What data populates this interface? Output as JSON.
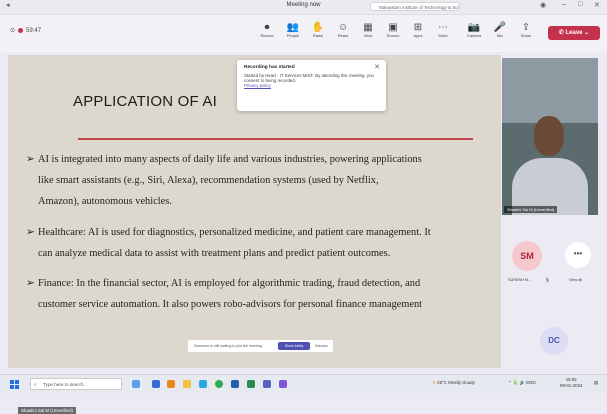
{
  "window": {
    "title": "Meeting now",
    "search_text": "Malayalam Institute of Technology & Science"
  },
  "toolbar": {
    "timer": "59:47",
    "items": [
      {
        "label": "Record",
        "glyph": "⏺"
      },
      {
        "label": "People",
        "glyph": "👥"
      },
      {
        "label": "Raise",
        "glyph": "✋"
      },
      {
        "label": "React",
        "glyph": "☺"
      },
      {
        "label": "View",
        "glyph": "▦"
      },
      {
        "label": "Rooms",
        "glyph": "▣"
      },
      {
        "label": "Apps",
        "glyph": "⊞"
      },
      {
        "label": "More",
        "glyph": "⋯"
      },
      {
        "label": "Camera",
        "glyph": "📷"
      },
      {
        "label": "Mic",
        "glyph": "🎤"
      },
      {
        "label": "Share",
        "glyph": "⇪"
      }
    ],
    "leave_label": "Leave"
  },
  "slide": {
    "title": "APPLICATION OF AI",
    "bullets": [
      {
        "lines": [
          "AI is integrated into many aspects of daily life and various industries, powering applications",
          "like smart assistants (e.g., Siri,  Alexa),  recommendation systems (used by Netflix,",
          "Amazon), autonomous vehicles."
        ]
      },
      {
        "lines": [
          "Healthcare: AI is used for diagnostics, personalized medicine, and patient care management. It",
          "can analyze medical data to assist with treatment plans and predict patient outcomes."
        ]
      },
      {
        "lines": [
          "Finance: In the financial sector, AI is employed for algorithmic trading, fraud detection, and",
          "customer service automation. It also powers robo-advisors for personal finance management"
        ]
      }
    ]
  },
  "toast": {
    "title": "Recording has started",
    "body": "Started by Head - IT Services MIST. By attending this meeting, you consent to being recorded.",
    "link": "Privacy policy"
  },
  "notice": {
    "text": "Someone is still waiting to join the meeting",
    "button": "Show lobby",
    "dismiss": "Dismiss"
  },
  "presenter_name": "Shaalini Sai M (Unverified)",
  "video_name": "Shaalini Sai M (Unverified)",
  "participants": {
    "sm_initials": "SM",
    "sm_label": "SURESH M...",
    "more_glyph": "•••",
    "more_label": "View all",
    "dc_initials": "DC"
  },
  "taskbar": {
    "search_placeholder": "Type here to search",
    "weather": "28°C  Mostly cloudy",
    "lang": "ENG",
    "time": "15:02",
    "date": "09-01-2024"
  }
}
